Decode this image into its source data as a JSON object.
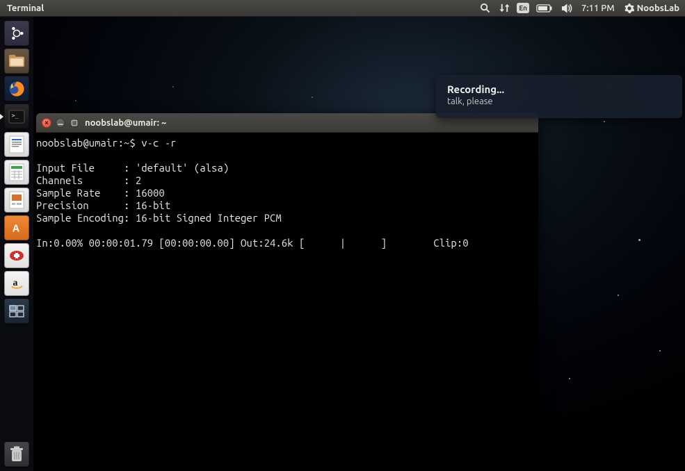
{
  "panel": {
    "app_title": "Terminal",
    "keyboard": "En",
    "time": "7:11 PM",
    "username": "NoobsLab"
  },
  "launcher": {
    "items": [
      {
        "name": "dash-icon"
      },
      {
        "name": "files-icon"
      },
      {
        "name": "firefox-icon"
      },
      {
        "name": "terminal-icon",
        "running": true
      },
      {
        "name": "writer-icon"
      },
      {
        "name": "calc-icon"
      },
      {
        "name": "impress-icon"
      },
      {
        "name": "software-center-icon"
      },
      {
        "name": "utility-icon"
      },
      {
        "name": "amazon-icon"
      },
      {
        "name": "workspace-switcher-icon"
      }
    ]
  },
  "terminal": {
    "window_title": "noobslab@umair: ~",
    "prompt_user": "noobslab@umair",
    "prompt_path": "~",
    "prompt_symbol": "$",
    "command": "v-c -r",
    "output": {
      "input_file_label": "Input File",
      "input_file_value": "'default' (alsa)",
      "channels_label": "Channels",
      "channels_value": "2",
      "sample_rate_label": "Sample Rate",
      "sample_rate_value": "16000",
      "precision_label": "Precision",
      "precision_value": "16-bit",
      "encoding_label": "Sample Encoding",
      "encoding_value": "16-bit Signed Integer PCM",
      "progress": "In:0.00% 00:00:01.79 [00:00:00.00] Out:24.6k [      |      ]        Clip:0"
    }
  },
  "notification": {
    "title": "Recording...",
    "body": "talk, please"
  }
}
